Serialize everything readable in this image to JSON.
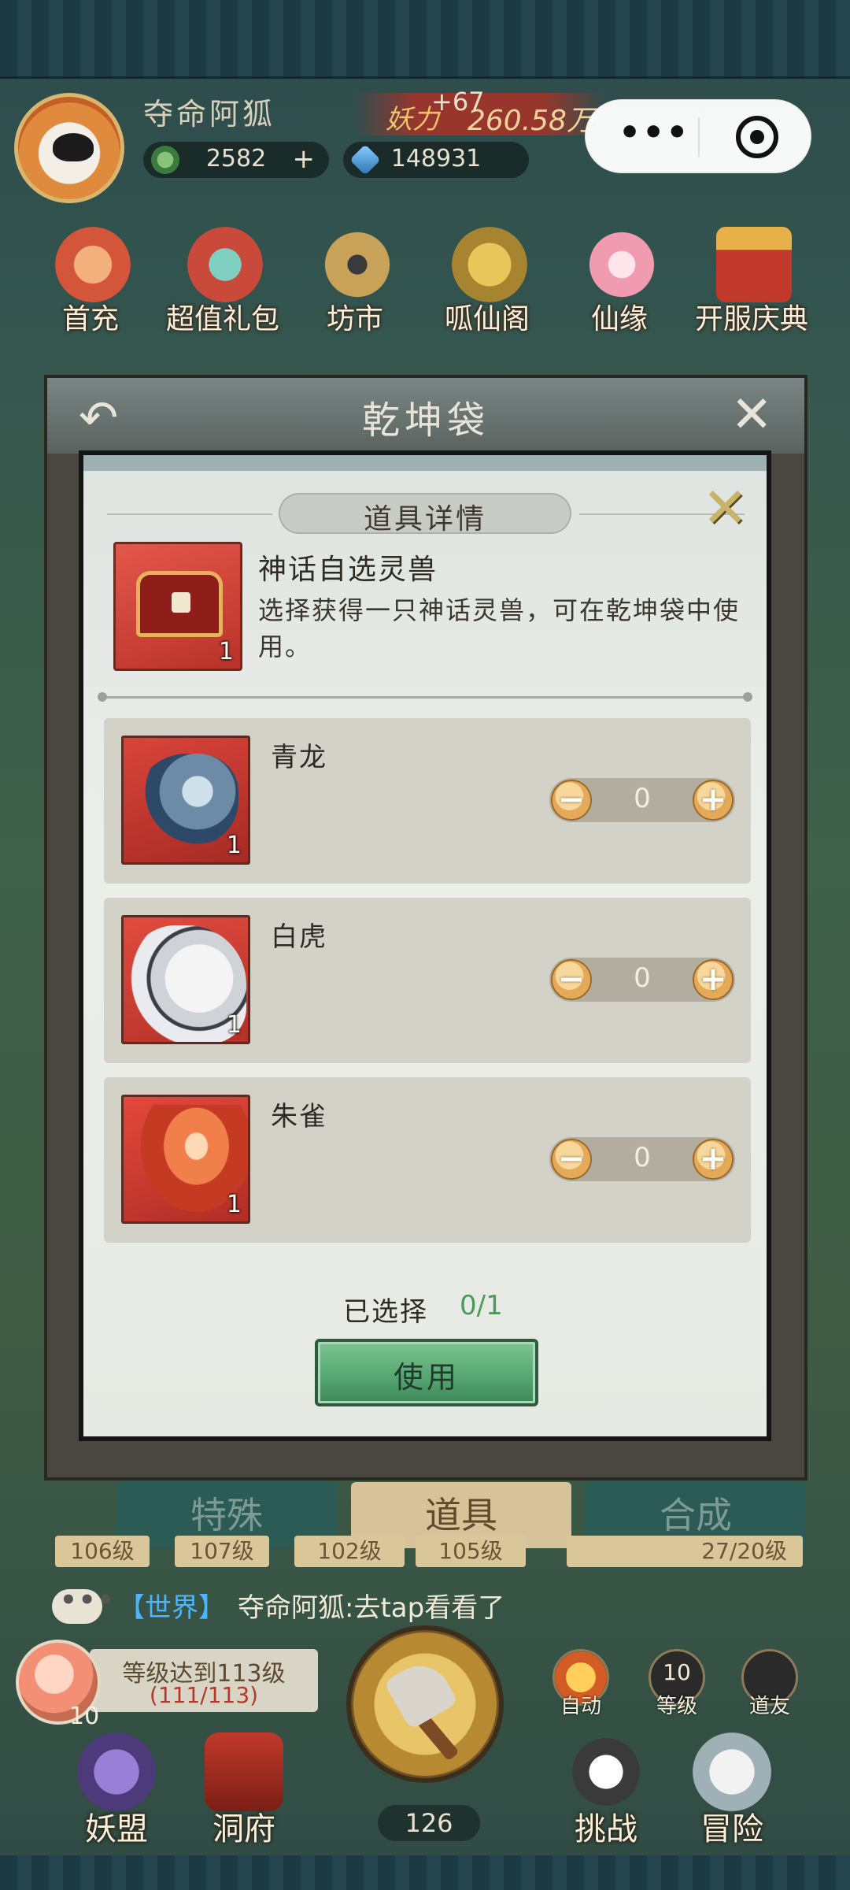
{
  "header": {
    "player_name": "夺命阿狐",
    "power_label": "妖力",
    "power_value": "260.58万",
    "power_gain": "+67",
    "currency1": "2582",
    "currency2": "148931"
  },
  "top_menu": [
    {
      "label": "首充"
    },
    {
      "label": "超值礼包"
    },
    {
      "label": "坊市"
    },
    {
      "label": "呱仙阁"
    },
    {
      "label": "仙缘"
    },
    {
      "label": "开服庆典"
    }
  ],
  "bag_dialog": {
    "title": "乾坤袋",
    "tabs": [
      "特殊",
      "道具",
      "合成"
    ],
    "level_chips": [
      "106级",
      "107级",
      "102级",
      "105级",
      "27/20级"
    ]
  },
  "detail_dialog": {
    "header": "道具详情",
    "item": {
      "name": "神话自选灵兽",
      "description": "选择获得一只神话灵兽，可在乾坤袋中使用。",
      "count": "1"
    },
    "options": [
      {
        "name": "青龙",
        "count": "1",
        "value": "0"
      },
      {
        "name": "白虎",
        "count": "1",
        "value": "0"
      },
      {
        "name": "朱雀",
        "count": "1",
        "value": "0"
      }
    ],
    "minus_symbol": "−",
    "plus_symbol": "+",
    "selected_label": "已选择",
    "selected_value": "0/1",
    "use_button": "使用"
  },
  "chat": {
    "channel_tag": "【世界】",
    "message": "夺命阿狐:去tap看看了"
  },
  "quest": {
    "title": "等级达到113级",
    "progress": "(111/113)",
    "peach_count": "10"
  },
  "bottom": {
    "energy": "126",
    "auto_label": "自动",
    "level_icon_value": "10",
    "level_label": "等级",
    "friends_label": "道友",
    "nav": [
      {
        "label": "妖盟"
      },
      {
        "label": "洞府"
      },
      {
        "label": "挑战"
      },
      {
        "label": "冒险"
      }
    ]
  },
  "colors": {
    "accent_green": "#58a874",
    "stepper_gold": "#e5a95a",
    "selected_green": "#4a9a5a",
    "chat_blue": "#4db5ff"
  }
}
